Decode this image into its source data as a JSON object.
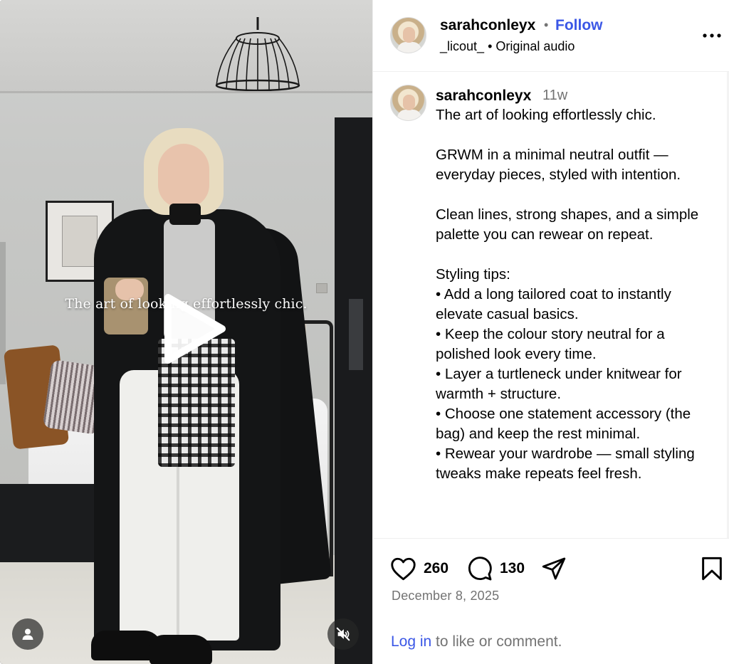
{
  "video": {
    "overlay_caption": "The art of looking effortlessly chic."
  },
  "post": {
    "username": "sarahconleyx",
    "follow_label": "Follow",
    "audio_author": "_licout_",
    "audio_label": "Original audio",
    "caption_time": "11w",
    "caption_text": "The art of looking effortlessly chic.\n\nGRWM in a minimal neutral outfit — everyday pieces, styled with intention.\n\nClean lines, strong shapes, and a simple palette you can rewear on repeat.\n\nStyling tips:\n• Add a long tailored coat to instantly elevate casual basics.\n• Keep the colour story neutral for a polished look every time.\n• Layer a turtleneck under knitwear for warmth + structure.\n• Choose one statement accessory (the bag) and keep the rest minimal.\n• Rewear your wardrobe — small styling tweaks make repeats feel fresh.",
    "likes": "260",
    "comments": "130",
    "date": "December 8, 2025",
    "login_link": "Log in",
    "login_suffix": " to like or comment."
  },
  "colors": {
    "link": "#3b57e6",
    "muted": "#737373",
    "divider": "#efefef"
  },
  "icons": [
    "play-icon",
    "user-icon",
    "mute-icon",
    "more-icon",
    "heart-icon",
    "comment-icon",
    "share-icon",
    "bookmark-icon"
  ]
}
